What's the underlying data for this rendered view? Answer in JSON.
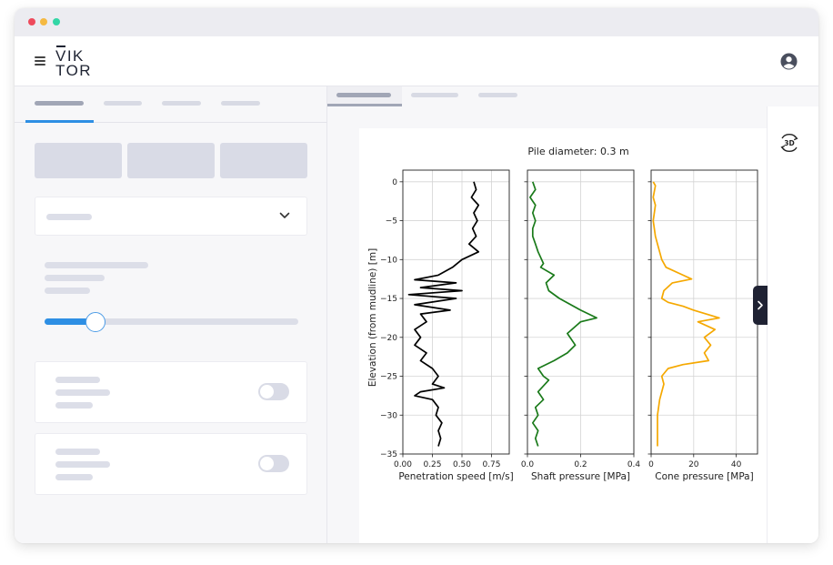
{
  "app": {
    "logo_line1": "VIK",
    "logo_line2": "TOR",
    "icons": {
      "menu": "hamburger-icon",
      "user": "user-icon",
      "dropdown": "chevron-down-icon",
      "collapse": "chevron-right-icon",
      "view3d": "rotate-3d-icon"
    },
    "view3d_label": "3D"
  },
  "colors": {
    "accent": "#2e8fe4",
    "series_speed": "#000000",
    "series_shaft": "#1a7a1a",
    "series_cone": "#f5a800",
    "dark_button": "#1f2233"
  },
  "chart_data": {
    "type": "line",
    "title": "Pile diameter: 0.3 m",
    "ylabel": "Elevation (from mudline) [m]",
    "ylim": [
      -35,
      1.5
    ],
    "yticks": [
      0,
      -5,
      -10,
      -15,
      -20,
      -25,
      -30,
      -35
    ],
    "grid": true,
    "panels": [
      {
        "xlabel": "Penetration speed [m/s]",
        "xlim": [
          0,
          0.9
        ],
        "xticks": [
          0,
          0.25,
          0.5,
          0.75
        ],
        "xtick_labels": [
          "0.00",
          "0.25",
          "0.50",
          "0.75"
        ],
        "color": "#000000",
        "points": [
          [
            0.6,
            0
          ],
          [
            0.62,
            -1
          ],
          [
            0.58,
            -2
          ],
          [
            0.64,
            -3
          ],
          [
            0.6,
            -4
          ],
          [
            0.63,
            -5
          ],
          [
            0.59,
            -6
          ],
          [
            0.62,
            -7
          ],
          [
            0.56,
            -8
          ],
          [
            0.64,
            -9
          ],
          [
            0.5,
            -10
          ],
          [
            0.42,
            -11
          ],
          [
            0.3,
            -12
          ],
          [
            0.1,
            -12.6
          ],
          [
            0.45,
            -13
          ],
          [
            0.15,
            -13.6
          ],
          [
            0.5,
            -14
          ],
          [
            0.05,
            -14.5
          ],
          [
            0.45,
            -15
          ],
          [
            0.1,
            -15.8
          ],
          [
            0.4,
            -16.5
          ],
          [
            0.15,
            -17
          ],
          [
            0.2,
            -18
          ],
          [
            0.1,
            -19
          ],
          [
            0.15,
            -20
          ],
          [
            0.1,
            -21
          ],
          [
            0.2,
            -22
          ],
          [
            0.15,
            -23
          ],
          [
            0.25,
            -24
          ],
          [
            0.3,
            -25
          ],
          [
            0.25,
            -26
          ],
          [
            0.35,
            -26.5
          ],
          [
            0.15,
            -27
          ],
          [
            0.1,
            -27.5
          ],
          [
            0.25,
            -28
          ],
          [
            0.3,
            -29
          ],
          [
            0.28,
            -30
          ],
          [
            0.33,
            -31
          ],
          [
            0.3,
            -32
          ],
          [
            0.32,
            -33
          ],
          [
            0.3,
            -34
          ]
        ]
      },
      {
        "xlabel": "Shaft pressure [MPa]",
        "xlim": [
          0,
          0.4
        ],
        "xticks": [
          0,
          0.2,
          0.4
        ],
        "xtick_labels": [
          "0.0",
          "0.2",
          "0.4"
        ],
        "color": "#1a7a1a",
        "points": [
          [
            0.02,
            0
          ],
          [
            0.03,
            -1
          ],
          [
            0.01,
            -2
          ],
          [
            0.03,
            -3
          ],
          [
            0.02,
            -4
          ],
          [
            0.03,
            -5
          ],
          [
            0.02,
            -6
          ],
          [
            0.02,
            -7
          ],
          [
            0.03,
            -8
          ],
          [
            0.04,
            -9
          ],
          [
            0.06,
            -10.5
          ],
          [
            0.05,
            -11
          ],
          [
            0.1,
            -12
          ],
          [
            0.07,
            -13
          ],
          [
            0.08,
            -14
          ],
          [
            0.12,
            -15
          ],
          [
            0.2,
            -16.5
          ],
          [
            0.26,
            -17.5
          ],
          [
            0.2,
            -18
          ],
          [
            0.15,
            -19.5
          ],
          [
            0.18,
            -21
          ],
          [
            0.15,
            -22
          ],
          [
            0.1,
            -23
          ],
          [
            0.04,
            -24
          ],
          [
            0.06,
            -25
          ],
          [
            0.08,
            -25.5
          ],
          [
            0.04,
            -27
          ],
          [
            0.06,
            -28
          ],
          [
            0.03,
            -29
          ],
          [
            0.04,
            -30
          ],
          [
            0.02,
            -31
          ],
          [
            0.04,
            -32
          ],
          [
            0.03,
            -33
          ],
          [
            0.04,
            -34
          ]
        ]
      },
      {
        "xlabel": "Cone pressure [MPa]",
        "xlim": [
          0,
          50
        ],
        "xticks": [
          0,
          20,
          40
        ],
        "xtick_labels": [
          "0",
          "20",
          "40"
        ],
        "color": "#f5a800",
        "points": [
          [
            1,
            0
          ],
          [
            2,
            -0.5
          ],
          [
            1,
            -2
          ],
          [
            2,
            -3
          ],
          [
            1,
            -5
          ],
          [
            2,
            -7
          ],
          [
            3,
            -8
          ],
          [
            5,
            -10
          ],
          [
            7,
            -11
          ],
          [
            15,
            -12
          ],
          [
            19,
            -12.5
          ],
          [
            10,
            -13
          ],
          [
            6,
            -14
          ],
          [
            5,
            -15
          ],
          [
            8,
            -15.5
          ],
          [
            15,
            -16
          ],
          [
            20,
            -16.5
          ],
          [
            32,
            -17.5
          ],
          [
            22,
            -18
          ],
          [
            30,
            -19
          ],
          [
            25,
            -20
          ],
          [
            28,
            -21
          ],
          [
            25,
            -22
          ],
          [
            27,
            -23
          ],
          [
            15,
            -23.5
          ],
          [
            8,
            -24
          ],
          [
            5,
            -25
          ],
          [
            6,
            -26
          ],
          [
            4,
            -28
          ],
          [
            3,
            -30
          ],
          [
            3,
            -32
          ],
          [
            3,
            -34
          ]
        ]
      }
    ]
  }
}
